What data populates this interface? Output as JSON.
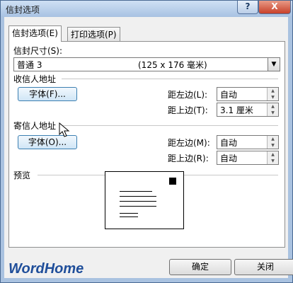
{
  "window": {
    "title": "信封选项",
    "help": "?",
    "close": "X"
  },
  "tabs": [
    {
      "label": "信封选项(E)",
      "active": true
    },
    {
      "label": "打印选项(P)",
      "active": false
    }
  ],
  "envelope_size": {
    "label": "信封尺寸(S):",
    "value": "普通 3",
    "dimensions": "(125 x 176 毫米)"
  },
  "recipient": {
    "heading": "收信人地址",
    "font_button": "字体(F)...",
    "from_left_label": "距左边(L):",
    "from_left_value": "自动",
    "from_top_label": "距上边(T):",
    "from_top_value": "3.1 厘米"
  },
  "sender": {
    "heading": "寄信人地址",
    "font_button": "字体(O)...",
    "from_left_label": "距左边(M):",
    "from_left_value": "自动",
    "from_top_label": "距上边(R):",
    "from_top_value": "自动"
  },
  "preview": {
    "heading": "预览"
  },
  "watermark": "WordHome",
  "buttons": {
    "ok": "确定",
    "close": "关闭"
  },
  "colors": {
    "title_bar": "#a9c3e3",
    "close_button": "#c7412a",
    "font_button": "#cfe5f6",
    "watermark": "#1f4e9a"
  }
}
